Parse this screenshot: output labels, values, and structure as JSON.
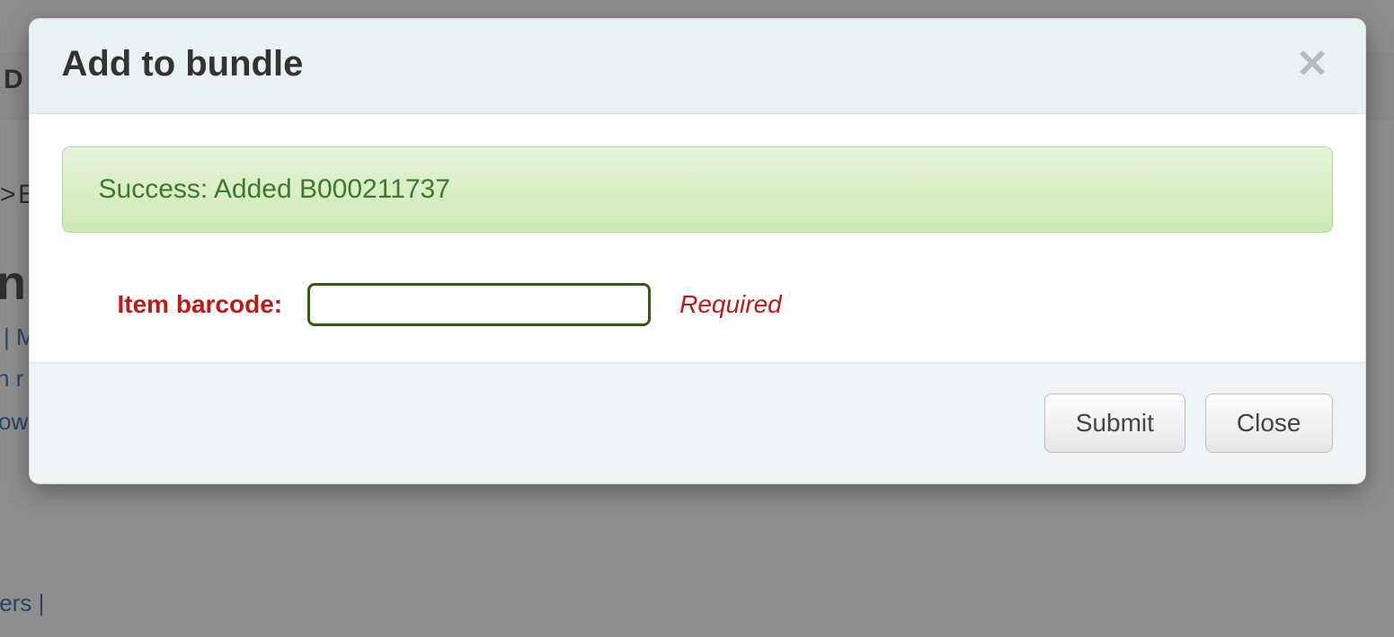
{
  "modal": {
    "title": "Add to bundle",
    "close_aria": "Close",
    "alert": "Success: Added B000211737",
    "field_label": "Item barcode:",
    "barcode_value": "",
    "required_hint": "Required",
    "submit_label": "Submit",
    "close_label": "Close"
  },
  "background": {
    "frag_d": "D",
    "frag_e": "E",
    "frag_n": "n",
    "frag_pipe_m": "| M",
    "frag_nr": "n r",
    "frag_ow": "ow",
    "frag_ters": "ters |",
    "frag_caret": ">"
  }
}
